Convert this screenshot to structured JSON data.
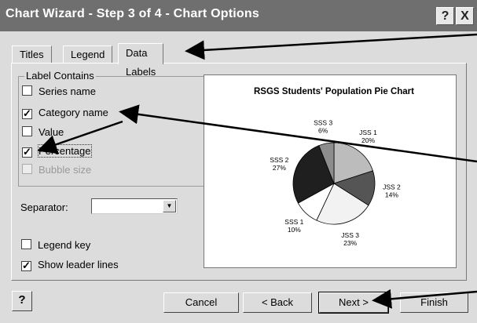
{
  "window": {
    "title": "Chart Wizard - Step 3 of 4 - Chart Options",
    "help_glyph": "?",
    "close_glyph": "X"
  },
  "tabs": [
    {
      "label": "Titles"
    },
    {
      "label": "Legend"
    },
    {
      "label": "Data Labels"
    }
  ],
  "label_contains": {
    "title": "Label Contains",
    "options": [
      {
        "label": "Series name",
        "checked": false,
        "enabled": true
      },
      {
        "label": "Category name",
        "checked": true,
        "enabled": true
      },
      {
        "label": "Value",
        "checked": false,
        "enabled": true
      },
      {
        "label": "Percentage",
        "checked": true,
        "enabled": true
      },
      {
        "label": "Bubble size",
        "checked": false,
        "enabled": false
      }
    ]
  },
  "separator": {
    "label": "Separator:",
    "value": ""
  },
  "legend_key": {
    "label": "Legend key",
    "checked": false
  },
  "leader_lines": {
    "label": "Show leader lines",
    "checked": true
  },
  "chart_data": {
    "type": "pie",
    "title": "RSGS Students' Population Pie Chart",
    "categories": [
      "JSS 1",
      "JSS 2",
      "JSS 3",
      "SSS 1",
      "SSS 2",
      "SSS 3"
    ],
    "values": [
      20,
      14,
      23,
      10,
      27,
      6
    ],
    "labels": [
      "20%",
      "14%",
      "23%",
      "10%",
      "27%",
      "6%"
    ],
    "colors": [
      "#bcbcbc",
      "#555555",
      "#f2f2f2",
      "#ffffff",
      "#1f1f1f",
      "#8d8d8d"
    ]
  },
  "buttons": {
    "help_glyph": "?",
    "cancel": "Cancel",
    "back": "< Back",
    "next": "Next >",
    "finish": "Finish"
  }
}
